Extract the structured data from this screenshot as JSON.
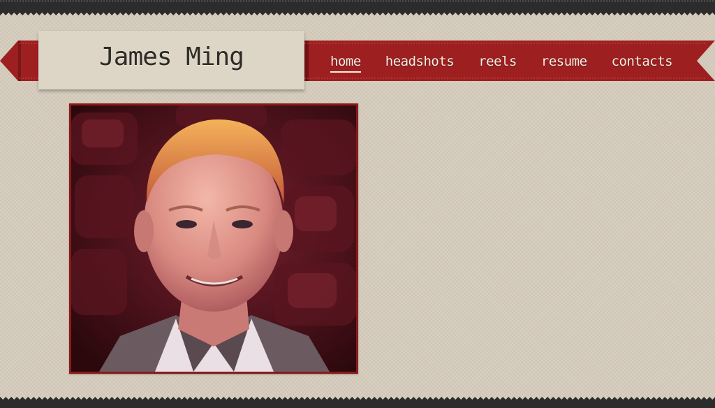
{
  "site": {
    "title": "James Ming"
  },
  "nav": {
    "items": [
      {
        "label": "home",
        "active": true
      },
      {
        "label": "headshots",
        "active": false
      },
      {
        "label": "reels",
        "active": false
      },
      {
        "label": "resume",
        "active": false
      },
      {
        "label": "contacts",
        "active": false
      }
    ]
  },
  "colors": {
    "ribbon": "#9e1f20",
    "ribbon_dark": "#6e1214",
    "background": "#d6cdbd",
    "frame": "#8a1a1a",
    "title_text": "#2e2a26"
  },
  "photo": {
    "subject": "portrait-photo"
  }
}
